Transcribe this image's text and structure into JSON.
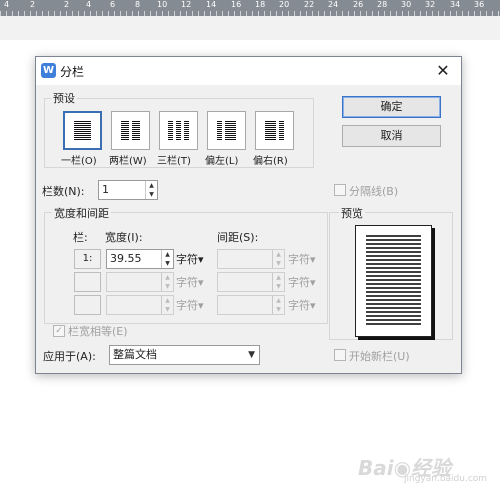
{
  "ruler": {
    "numbers": [
      "4",
      "2",
      "2",
      "4",
      "6",
      "8",
      "10",
      "12",
      "14",
      "16",
      "18",
      "20",
      "22",
      "24",
      "26",
      "28",
      "30",
      "32",
      "34",
      "36"
    ]
  },
  "dialog": {
    "app_icon": "W",
    "title": "分栏",
    "close_glyph": "✕",
    "presets_label": "预设",
    "presets": [
      {
        "label": "一栏(O)",
        "selected": true
      },
      {
        "label": "两栏(W)",
        "selected": false
      },
      {
        "label": "三栏(T)",
        "selected": false
      },
      {
        "label": "偏左(L)",
        "selected": false
      },
      {
        "label": "偏右(R)",
        "selected": false
      }
    ],
    "ok_label": "确定",
    "cancel_label": "取消",
    "num_columns_label": "栏数(N):",
    "num_columns_value": "1",
    "line_between_label": "分隔线(B)",
    "width_spacing_label": "宽度和间距",
    "col_header": "栏:",
    "width_header": "宽度(I):",
    "spacing_header": "间距(S):",
    "rows": [
      {
        "col": "1:",
        "width": "39.55",
        "unit": "字符▾",
        "spacing_unit": "字符▾"
      },
      {
        "col": "",
        "width": "",
        "unit": "字符▾",
        "spacing_unit": "字符▾"
      },
      {
        "col": "",
        "width": "",
        "unit": "字符▾",
        "spacing_unit": "字符▾"
      }
    ],
    "equal_width_label": "栏宽相等(E)",
    "preview_label": "预览",
    "apply_to_label": "应用于(A):",
    "apply_to_value": "整篇文档",
    "new_column_label": "开始新栏(U)",
    "accent_color": "#3a6fb3"
  },
  "watermark": {
    "text": "Bai◉经验",
    "sub": "jingyan.baidu.com"
  }
}
